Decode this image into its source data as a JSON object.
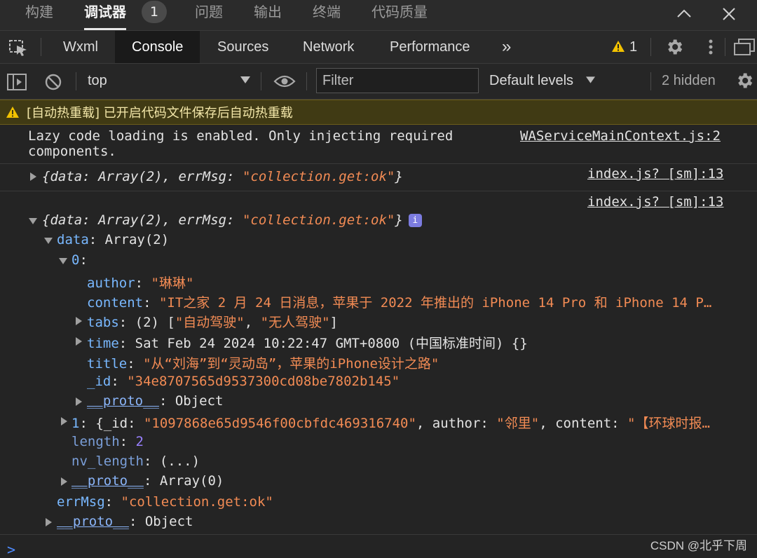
{
  "ide_tabs": {
    "build": "构建",
    "debugger": "调试器",
    "debugger_badge": "1",
    "problems": "问题",
    "output": "输出",
    "terminal": "终端",
    "code_quality": "代码质量"
  },
  "devtools_tabs": {
    "wxml": "Wxml",
    "console": "Console",
    "sources": "Sources",
    "network": "Network",
    "performance": "Performance",
    "more": "»",
    "warning_count": "1"
  },
  "toolbar": {
    "context": "top",
    "filter_placeholder": "Filter",
    "levels": "Default levels",
    "hidden": "2 hidden"
  },
  "warning_banner": "[自动热重载] 已开启代码文件保存后自动热重载",
  "messages": {
    "lazy_line1": "Lazy code loading is enabled. Only injecting required",
    "lazy_line2": "components.",
    "lazy_source": "WAServiceMainContext.js:2",
    "collapsed_source": "index.js? [sm]:13",
    "expanded_source": "index.js? [sm]:13",
    "obj_summary_prefix": "{data: Array(2), errMsg: ",
    "obj_summary_str": "\"collection.get:ok\"",
    "obj_summary_suffix": "}",
    "info_icon": "i"
  },
  "tree": {
    "data_key": "data",
    "data_val": ": Array(2)",
    "item0_key": "0",
    "author_key": "author",
    "author_val": "\"琳琳\"",
    "content_key": "content",
    "content_val": "\"IT之家 2 月 24 日消息，苹果于 2022 年推出的 iPhone 14 Pro 和 iPhone 14 P…",
    "tabs_key": "tabs",
    "tabs_prefix": ": (2) [",
    "tabs_v1": "\"自动驾驶\"",
    "tabs_sep": ", ",
    "tabs_v2": "\"无人驾驶\"",
    "tabs_suffix": "]",
    "time_key": "time",
    "time_val": ": Sat Feb 24 2024 10:22:47 GMT+0800 (中国标准时间) {}",
    "title_key": "title",
    "title_val": "\"从“刘海”到“灵动岛”，苹果的iPhone设计之路\"",
    "id_key": "_id",
    "id_val": "\"34e8707565d9537300cd08be7802b145\"",
    "proto_key": "__proto__",
    "proto_obj": ": Object",
    "item1_key": "1",
    "item1_p1": ": {_id: ",
    "item1_id": "\"1097868e65d9546f00cbfdc469316740\"",
    "item1_p2": ", author: ",
    "item1_author": "\"邻里\"",
    "item1_p3": ", content: ",
    "item1_content": "\"【环球时报…",
    "length_key": "length",
    "length_val": "2",
    "nvlen_key": "nv_length",
    "nvlen_val": ": (...)",
    "proto_arr": ": Array(0)",
    "errmsg_key": "errMsg",
    "errmsg_val": "\"collection.get:ok\"",
    "proto_root": ": Object"
  },
  "prompt_symbol": ">",
  "watermark": "CSDN @北乎下周",
  "colors": {
    "background": "#242424",
    "string": "#f28b54",
    "key": "#79b8ff",
    "number": "#9980ff",
    "warning_bg": "#403a14",
    "warning_icon": "#f2c200",
    "prompt": "#4f8cff"
  }
}
